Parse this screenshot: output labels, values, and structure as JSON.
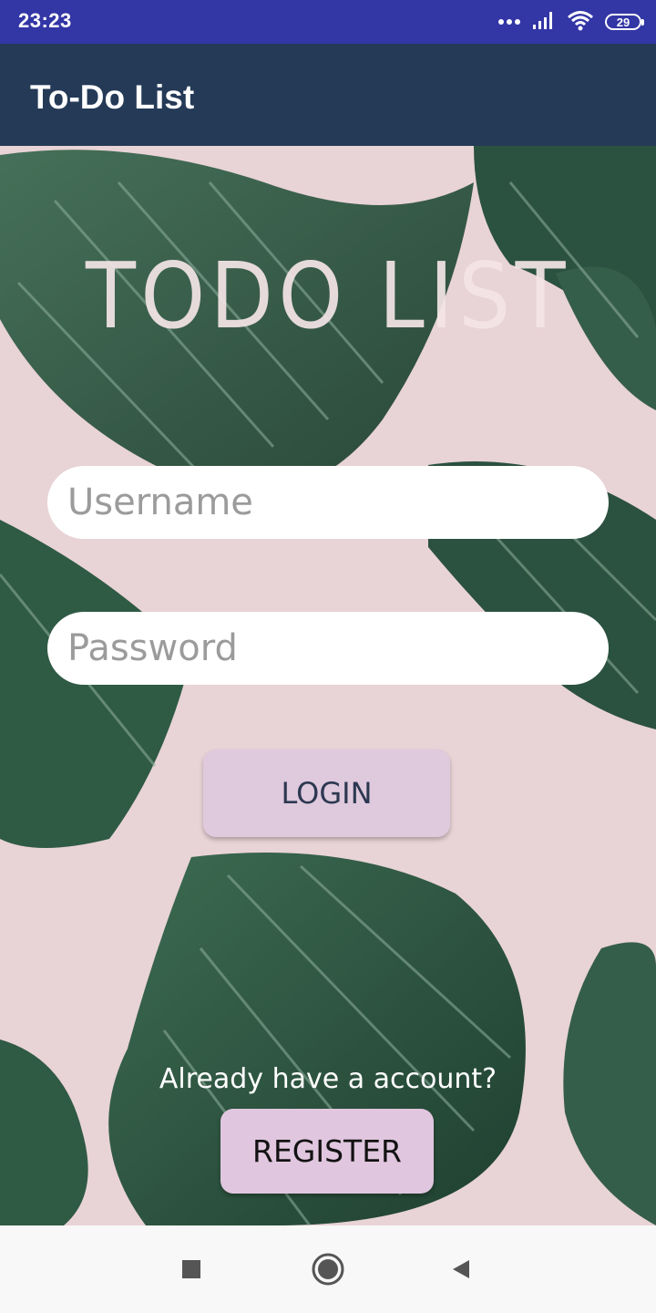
{
  "status_bar": {
    "time": "23:23",
    "battery_level": "29",
    "background": "#3336a5"
  },
  "app_bar": {
    "title": "To-Do List",
    "background": "#243a57"
  },
  "login": {
    "hero_title": "TODO LIST",
    "username_placeholder": "Username",
    "password_placeholder": "Password",
    "login_label": "LOGIN",
    "account_prompt": "Already have a account?",
    "register_label": "REGISTER"
  },
  "theme": {
    "content_background": "#e8d3d6",
    "leaf_color": "#2f5a44",
    "button_color": "#e0c6de"
  },
  "nav_bar": {
    "buttons": [
      "recents-icon",
      "home-icon",
      "back-icon"
    ]
  }
}
